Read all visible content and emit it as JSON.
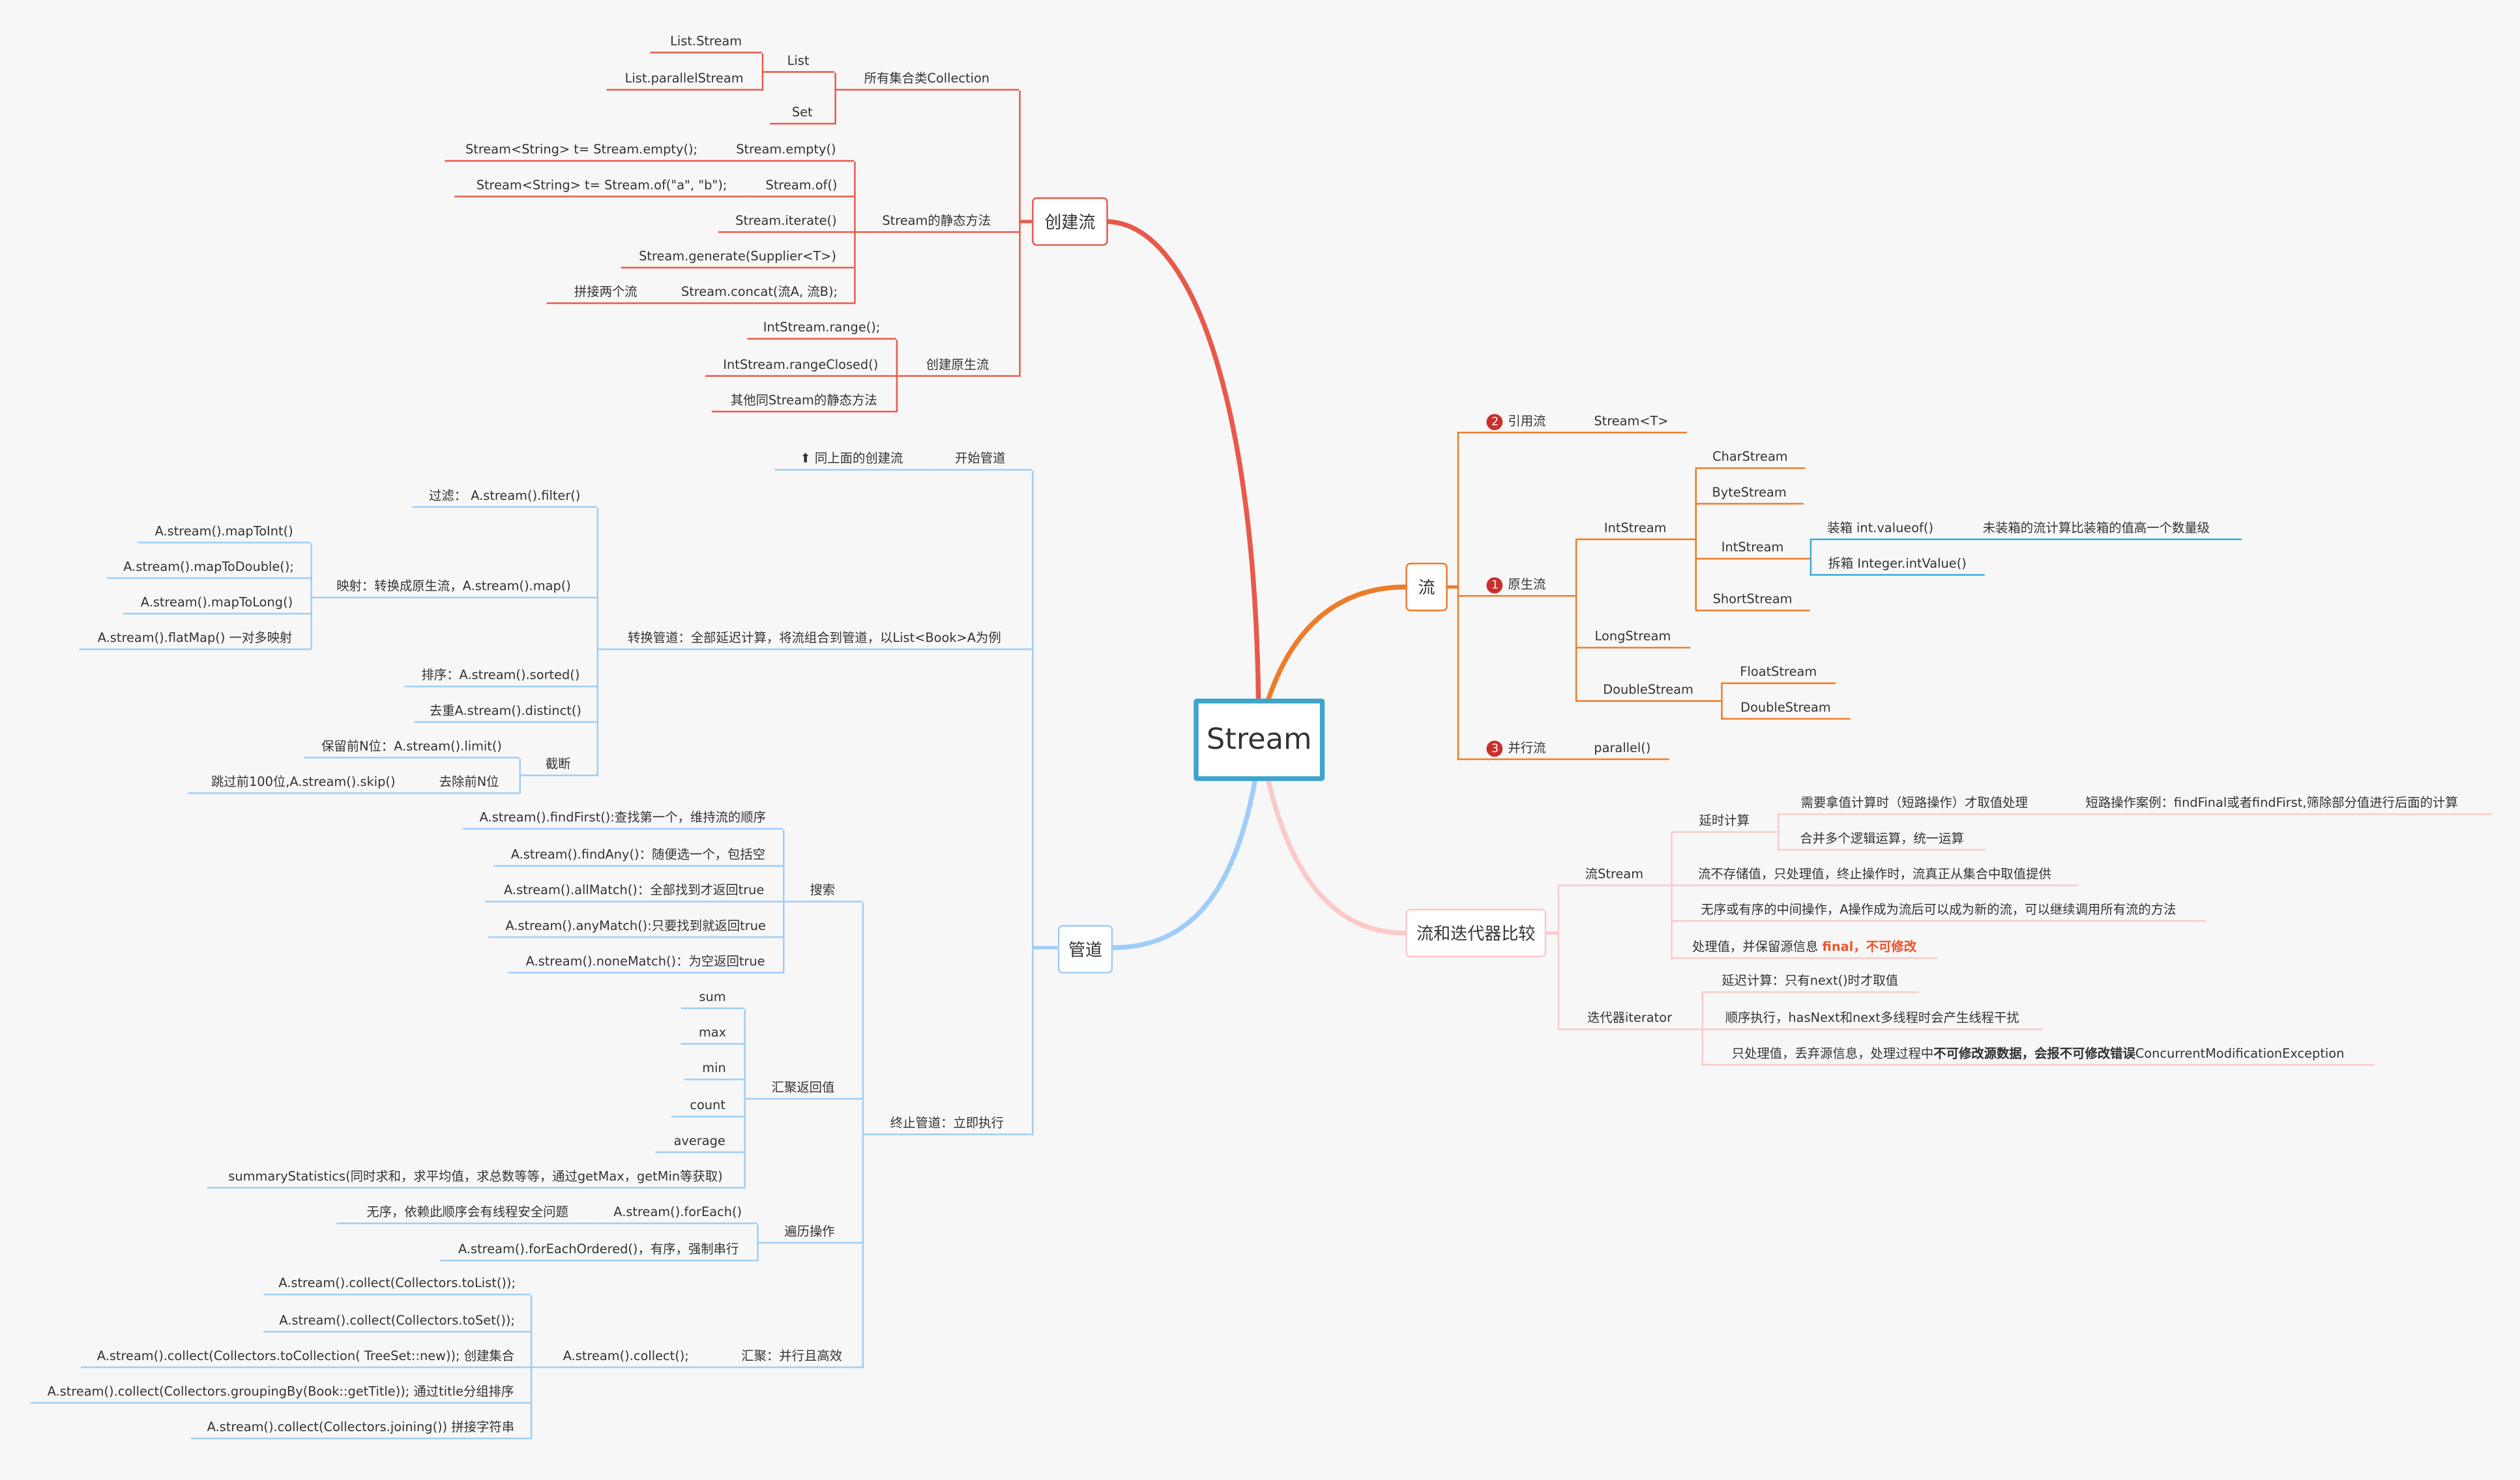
{
  "root": {
    "title": "Stream"
  },
  "colors": {
    "create": "#e8594a",
    "pipeline": "#9fcdf7",
    "streams": "#ec7c2a",
    "compare": "#fcc9c9",
    "boxing": "#3aa8d8",
    "root_border": "#3ea4cf",
    "badge": "#c9302c",
    "highlight": "#f0532a"
  },
  "create": {
    "title": "创建流",
    "collection": {
      "label": "所有集合类Collection",
      "list": "List",
      "list_stream": "List.Stream",
      "list_parallel": "List.parallelStream",
      "set": "Set"
    },
    "static": {
      "label": "Stream的静态方法",
      "items": [
        {
          "method": "Stream.empty()",
          "note": "Stream<String>  t= Stream.empty();"
        },
        {
          "method": "Stream.of()",
          "note": "Stream<String>  t= Stream.of(\"a\", \"b\");"
        },
        {
          "method": "Stream.iterate()"
        },
        {
          "method": "Stream.generate(Supplier<T>)"
        },
        {
          "method": "Stream.concat(流A, 流B);",
          "note": "拼接两个流"
        }
      ]
    },
    "primitive": {
      "label": "创建原生流",
      "items": [
        "IntStream.range();",
        "IntStream.rangeClosed()",
        "其他同Stream的静态方法"
      ]
    }
  },
  "pipeline": {
    "title": "管道",
    "start": {
      "label": "开始管道",
      "note": "同上面的创建流",
      "icon": "arrow-up-icon"
    },
    "transform": {
      "label": "转换管道：全部延迟计算，将流组合到管道，以List<Book>A为例",
      "filter": "过滤： A.stream().filter()",
      "map": {
        "label": "映射：转换成原生流，A.stream().map()",
        "items": [
          "A.stream().mapToInt()",
          "A.stream().mapToDouble();",
          "A.stream().mapToLong()",
          "A.stream().flatMap() 一对多映射"
        ]
      },
      "sorted": "排序：A.stream().sorted()",
      "distinct": "去重A.stream().distinct()",
      "truncate": {
        "label": "截断",
        "limit": "保留前N位：A.stream().limit()",
        "skip": "去除前N位",
        "skip_note": "跳过前100位,A.stream().skip()"
      }
    },
    "terminal": {
      "label": "终止管道：立即执行",
      "search": {
        "label": "搜索",
        "items": [
          "A.stream().findFirst():查找第一个，维持流的顺序",
          "A.stream().findAny()：随便选一个，包括空",
          "A.stream().allMatch()：全部找到才返回true",
          "A.stream().anyMatch():只要找到就返回true",
          "A.stream().noneMatch()：为空返回true"
        ]
      },
      "reduce": {
        "label": "汇聚返回值",
        "items": [
          "sum",
          "max",
          "min",
          "count",
          "average",
          "summaryStatistics(同时求和，求平均值，求总数等等，通过getMax，getMin等获取)"
        ]
      },
      "traverse": {
        "label": "遍历操作",
        "for_each": "A.stream().forEach()",
        "for_each_note": "无序，依赖此顺序会有线程安全问题",
        "for_each_ordered": "A.stream().forEachOrdered()，有序，强制串行"
      },
      "collect": {
        "label": "汇聚：并行且高效",
        "method": "A.stream().collect();",
        "items": [
          "A.stream().collect(Collectors.toList());",
          "A.stream().collect(Collectors.toSet());",
          "A.stream().collect(Collectors.toCollection( TreeSet::new)); 创建集合",
          "A.stream().collect(Collectors.groupingBy(Book::getTitle)); 通过title分组排序",
          "A.stream().collect(Collectors.joining()) 拼接字符串"
        ]
      }
    }
  },
  "streams": {
    "title": "流",
    "reference": {
      "badge": "2",
      "label": "引用流",
      "item": "Stream<T>"
    },
    "native": {
      "badge": "1",
      "label": "原生流",
      "int_stream": {
        "label": "IntStream",
        "items": [
          "CharStream",
          "ByteStream",
          "IntStream",
          "ShortStream"
        ],
        "boxing": {
          "box": "装箱 int.valueof()",
          "box_note": "未装箱的流计算比装箱的值高一个数量级",
          "unbox": "拆箱 Integer.intValue()"
        }
      },
      "long_stream": "LongStream",
      "double_stream": {
        "label": "DoubleStream",
        "items": [
          "FloatStream",
          "DoubleStream"
        ]
      }
    },
    "parallel": {
      "badge": "3",
      "label": "并行流",
      "item": "parallel()"
    }
  },
  "compare": {
    "title": "流和迭代器比较",
    "stream": {
      "label": "流Stream",
      "lazy": {
        "label": "延时计算",
        "short_circuit": "需要拿值计算时（短路操作）才取值处理",
        "short_circuit_note": "短路操作案例：findFinal或者findFirst,筛除部分值进行后面的计算",
        "merge": "合并多个逻辑运算，统一运算"
      },
      "no_store": "流不存储值，只处理值，终止操作时，流真正从集合中取值提供",
      "intermediate": "无序或有序的中间操作，A操作成为流后可以成为新的流，可以继续调用所有流的方法",
      "keep_source": "处理值，并保留源信息 ",
      "keep_source_highlight": "final，不可修改"
    },
    "iterator": {
      "label": "迭代器iterator",
      "lazy": "延迟计算：只有next()时才取值",
      "sequential": "顺序执行，hasNext和next多线程时会产生线程干扰",
      "discard_a": "只处理值，丢弃源信息，处理过程中",
      "discard_bold": "不可修改源数据，会报不可修改错误",
      "discard_b": "ConcurrentModificationException"
    }
  }
}
